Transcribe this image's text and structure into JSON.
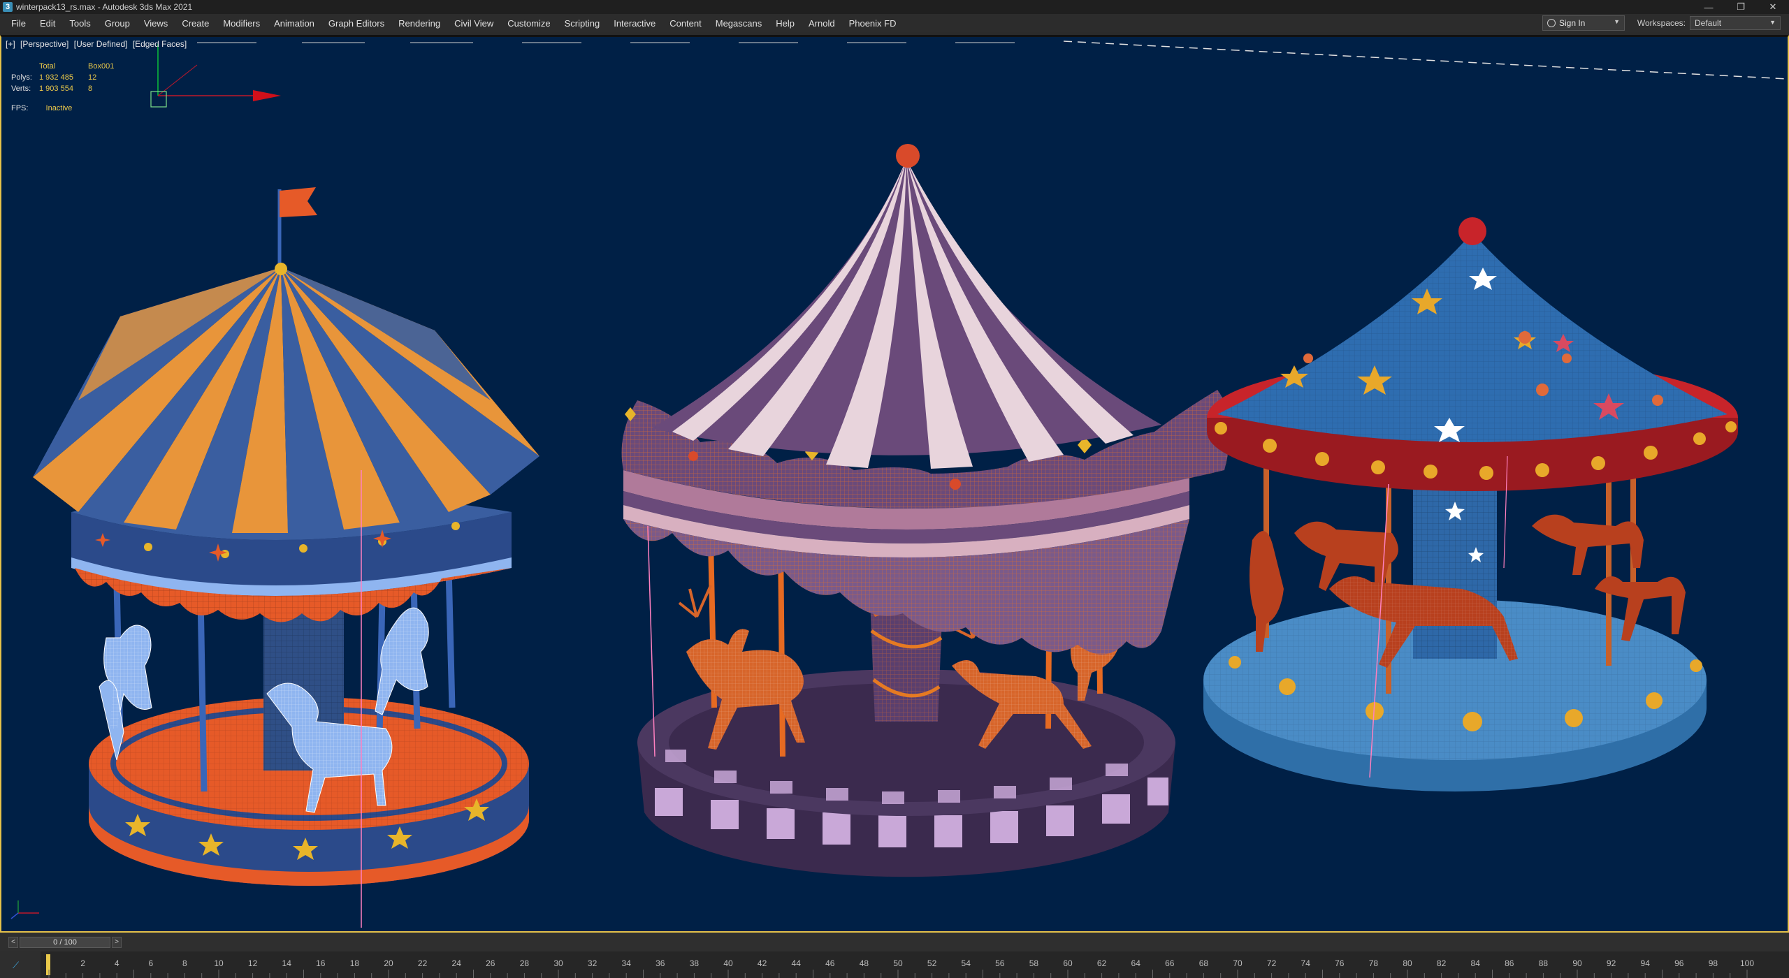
{
  "window": {
    "title": "winterpack13_rs.max - Autodesk 3ds Max 2021",
    "app_icon_letter": "3",
    "controls": [
      "—",
      "❐",
      "✕"
    ]
  },
  "menu": [
    "File",
    "Edit",
    "Tools",
    "Group",
    "Views",
    "Create",
    "Modifiers",
    "Animation",
    "Graph Editors",
    "Rendering",
    "Civil View",
    "Customize",
    "Scripting",
    "Interactive",
    "Content",
    "Megascans",
    "Help",
    "Arnold",
    "Phoenix FD"
  ],
  "account": {
    "sign_in_label": "Sign In"
  },
  "workspaces": {
    "label": "Workspaces:",
    "selected": "Default"
  },
  "viewport": {
    "labels": [
      "[+]",
      "[Perspective]",
      "[User Defined]",
      "[Edged Faces]"
    ],
    "stats": {
      "header": [
        "",
        "Total",
        "Box001"
      ],
      "rows": [
        {
          "key": "Polys:",
          "total": "1 932 485",
          "selected": "12"
        },
        {
          "key": "Verts:",
          "total": "1 903 554",
          "selected": "8"
        }
      ]
    },
    "fps": {
      "label": "FPS:",
      "value": "Inactive"
    },
    "background_color": "#002046"
  },
  "time_slider": {
    "value": "0 / 100",
    "prev": "<",
    "next": ">"
  },
  "timeline": {
    "labels": [
      "2",
      "4",
      "6",
      "8",
      "10",
      "12",
      "14",
      "16",
      "18",
      "20",
      "22",
      "24",
      "26",
      "28",
      "30",
      "32",
      "34",
      "36",
      "38",
      "40",
      "42",
      "44",
      "46",
      "48",
      "50",
      "52",
      "54",
      "56",
      "58",
      "60",
      "62",
      "64",
      "66",
      "68",
      "70",
      "72",
      "74",
      "76",
      "78",
      "80",
      "82",
      "84",
      "86",
      "88",
      "90",
      "92",
      "94",
      "96",
      "98",
      "100"
    ]
  }
}
